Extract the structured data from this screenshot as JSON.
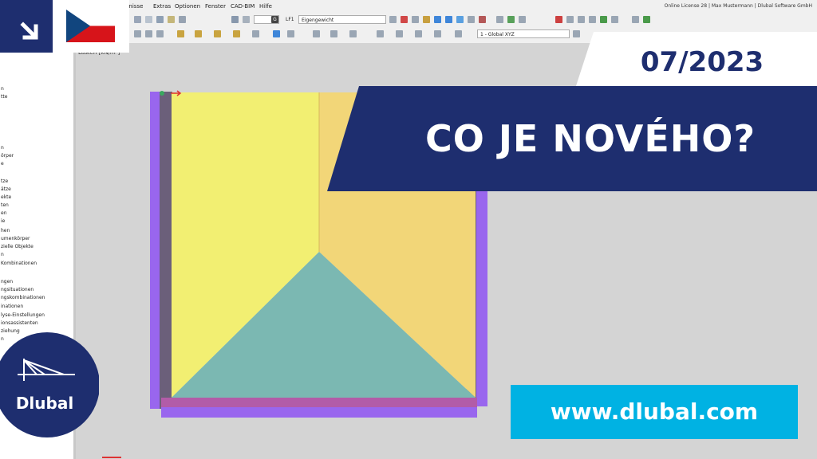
{
  "menubar": {
    "items": [
      "...ebnisse",
      "Extras",
      "Optionen",
      "Fenster",
      "CAD-BIM",
      "Hilfe"
    ],
    "license": "Online License 28 | Max Mustermann | Dlubal Software GmbH"
  },
  "toolbar": {
    "load_case_badge": "G",
    "load_case_id": "LF1",
    "load_case_name": "Eigengewicht",
    "coordinate_system": "1 - Global XYZ"
  },
  "navigator": {
    "items": [
      "n",
      "tte",
      "",
      "",
      "",
      "",
      "",
      "n",
      "örper",
      "e",
      "",
      "",
      "tze",
      "ätze",
      "ekte",
      "ten",
      "en",
      "ie",
      "hen",
      "umenkörper",
      "zielle Objekte",
      "n",
      "Kombinationen",
      "",
      "ngen",
      "ngsituationen",
      "ngskombinationen",
      "inationen",
      "lyse-Einstellungen",
      "ionsassistenten",
      "ziehung",
      "n"
    ]
  },
  "workspace": {
    "label": "Lasten [kN/m²]"
  },
  "promo": {
    "date": "07/2023",
    "title": "CO JE NOVÉHO?",
    "url": "www.dlubal.com",
    "logo_text": "Dlubal"
  },
  "colors": {
    "navy": "#1e2e6f",
    "cyan": "#00b2e3",
    "yellow": "#f2ef72",
    "orange": "#f2d678",
    "teal": "#7bb8b2",
    "purple": "#9966ee"
  },
  "icons": {
    "arrow": "arrow-down-right-icon",
    "flag": "czech-flag",
    "logo": "dlubal-bridge-logo"
  }
}
